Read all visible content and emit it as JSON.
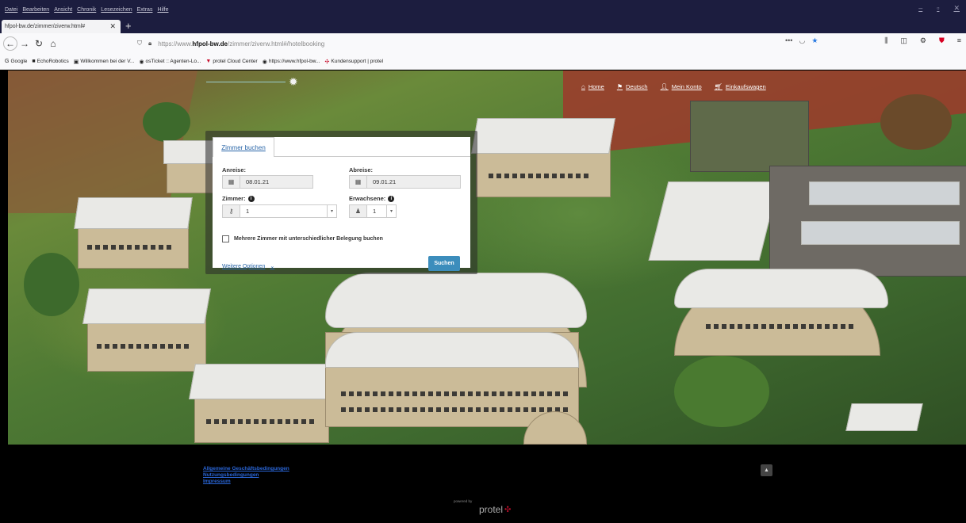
{
  "browser": {
    "menu": [
      "Datei",
      "Bearbeiten",
      "Ansicht",
      "Chronik",
      "Lesezeichen",
      "Extras",
      "Hilfe"
    ],
    "tab_title": "hfpol-bw.de/zimmer/ziverw.html#",
    "url_prefix": "https://www.",
    "url_host": "hfpol-bw.de",
    "url_path": "/zimmer/ziverw.html#/hotelbooking",
    "url_more": "•••",
    "bookmarks": [
      {
        "label": "Google",
        "icon": "G"
      },
      {
        "label": "EchoRobotics",
        "icon": "■"
      },
      {
        "label": "Willkommen bei der V...",
        "icon": "▣"
      },
      {
        "label": "osTicket :: Agenten-Lo...",
        "icon": "◉"
      },
      {
        "label": "protel Cloud Center",
        "icon": "▼"
      },
      {
        "label": "https://www.hfpol-bw...",
        "icon": "◉"
      },
      {
        "label": "Kundensupport | protel",
        "icon": "✣"
      }
    ]
  },
  "nav": {
    "home": "Home",
    "language": "Deutsch",
    "account": "Mein Konto",
    "cart": "Einkaufswagen"
  },
  "booking": {
    "tab": "Zimmer buchen",
    "arrival_label": "Anreise:",
    "arrival_value": "08.01.21",
    "departure_label": "Abreise:",
    "departure_value": "09.01.21",
    "rooms_label": "Zimmer:",
    "rooms_value": "1",
    "adults_label": "Erwachsene:",
    "adults_value": "1",
    "multi_room_label": "Mehrere Zimmer mit unterschiedlicher Belegung buchen",
    "more_options": "Weitere Optionen",
    "search_button": "Suchen"
  },
  "footer": {
    "links": [
      "Allgemeine Geschäftsbedingungen",
      "Nutzungsbedingungen",
      "Impressum"
    ],
    "powered_by": "powered by",
    "brand": "protel"
  }
}
